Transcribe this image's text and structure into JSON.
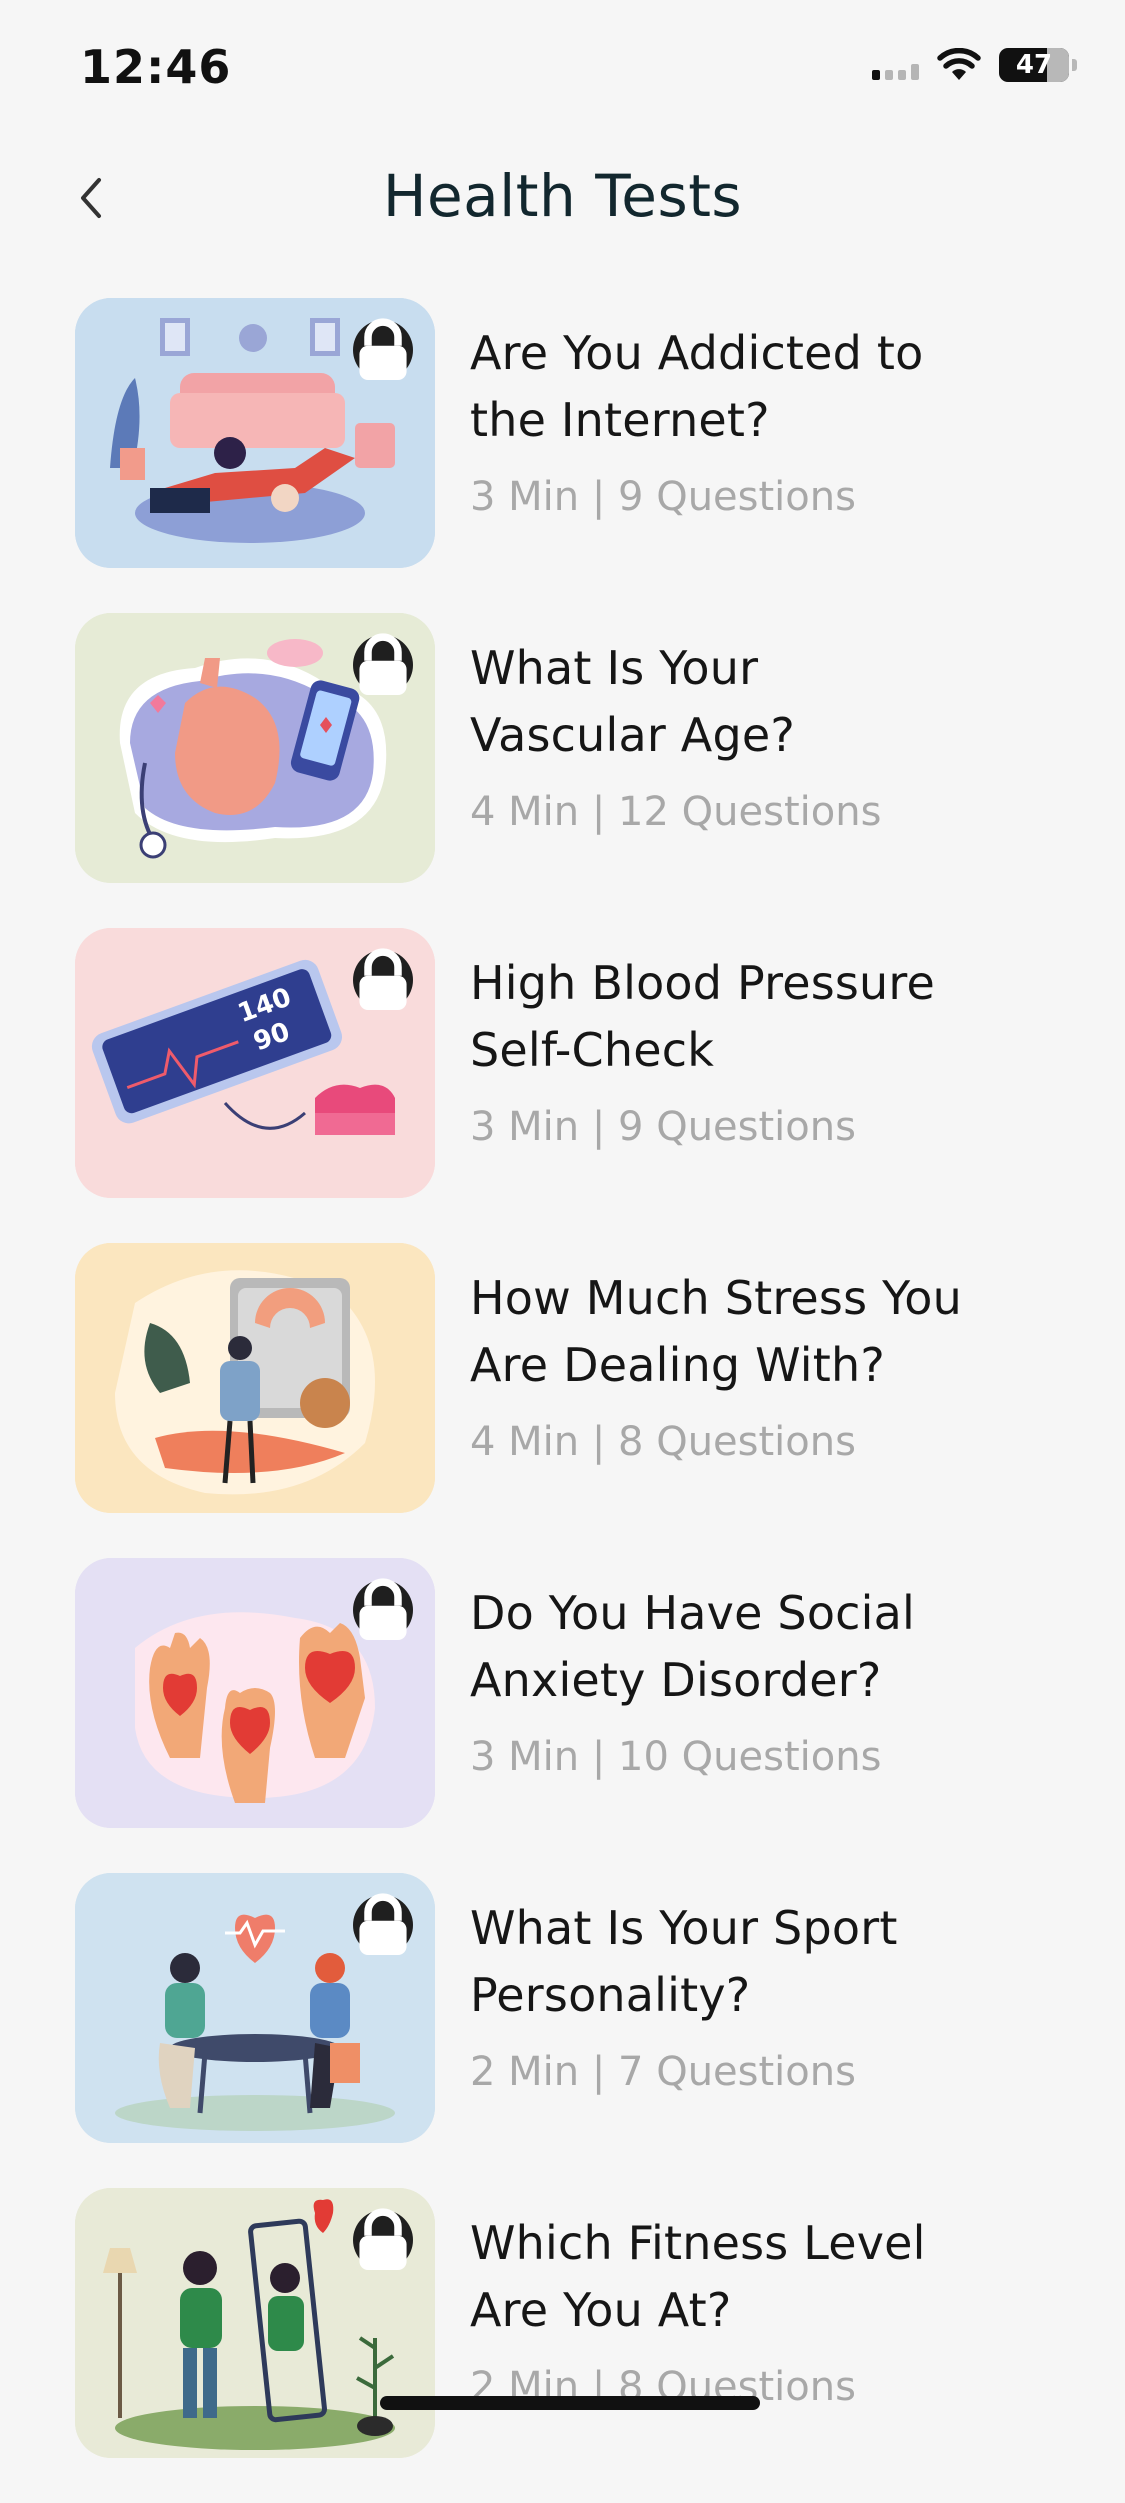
{
  "status_bar": {
    "time": "12:46",
    "battery": "47"
  },
  "header": {
    "title": "Health Tests"
  },
  "tests": [
    {
      "title_line1": "Are You Addicted to",
      "title_line2": "the Internet?",
      "meta": "3 Min | 9 Questions",
      "bg": "#c8ddef",
      "illustration": "person-on-laptop"
    },
    {
      "title_line1": "What Is Your",
      "title_line2": "Vascular Age?",
      "meta": "4 Min | 12 Questions",
      "bg": "#e6ebd6",
      "illustration": "heart-stethoscope-phone"
    },
    {
      "title_line1": "High Blood Pressure",
      "title_line2": "Self-Check",
      "meta": "3 Min | 9 Questions",
      "bg": "#f9dbdb",
      "illustration": "blood-pressure-monitor"
    },
    {
      "title_line1": "How Much Stress You",
      "title_line2": "Are Dealing With?",
      "meta": "4 Min | 8 Questions",
      "bg": "#fbe6bf",
      "illustration": "scale-vegetables"
    },
    {
      "title_line1": "Do You Have Social",
      "title_line2": "Anxiety Disorder?",
      "meta": "3 Min | 10 Questions",
      "bg": "#e4e0f4",
      "illustration": "hands-hearts"
    },
    {
      "title_line1": "What Is Your Sport",
      "title_line2": "Personality?",
      "meta": "2 Min | 7 Questions",
      "bg": "#cfe2f0",
      "illustration": "doctor-patient"
    },
    {
      "title_line1": "Which Fitness Level",
      "title_line2": "Are You At?",
      "meta": "2 Min | 8 Questions",
      "bg": "#e8ead7",
      "illustration": "person-mirror"
    }
  ],
  "icons": {
    "back": "chevron-left-icon",
    "lock": "lock-icon",
    "wifi": "wifi-icon",
    "signal": "signal-icon",
    "battery": "battery-icon"
  }
}
